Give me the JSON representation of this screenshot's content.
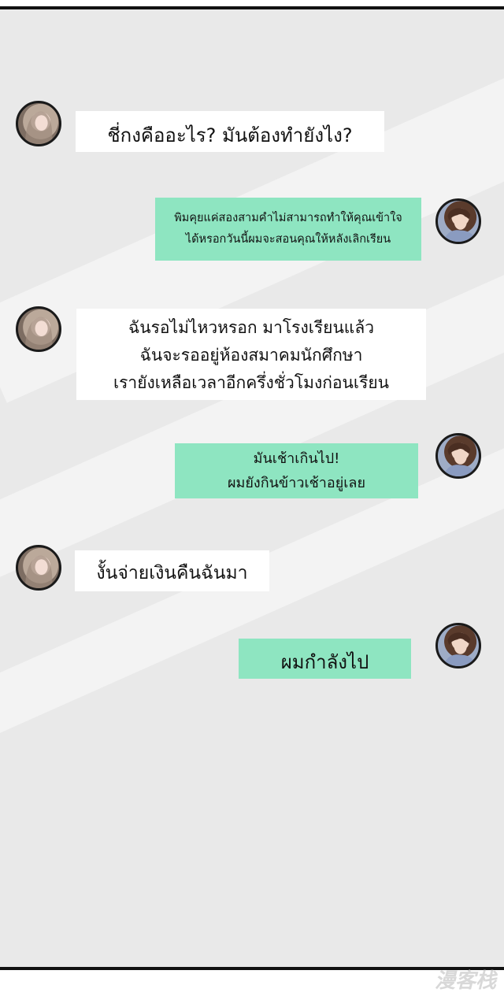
{
  "colors": {
    "background": "#e9e9e9",
    "incoming_bubble": "#ffffff",
    "outgoing_bubble": "#8ee5c1",
    "border": "#111111"
  },
  "messages": [
    {
      "sender": "girl",
      "lines": [
        "ชี่กงคืออะไร? มันต้องทำยังไง?"
      ]
    },
    {
      "sender": "boy",
      "lines": [
        "พิมคุยแค่สองสามคำไม่สามารถทำให้คุณเข้าใจ",
        "ได้หรอกวันนี้ผมจะสอนคุณให้หลังเลิกเรียน"
      ]
    },
    {
      "sender": "girl",
      "lines": [
        "ฉันรอไม่ไหวหรอก มาโรงเรียนแล้ว",
        "ฉันจะรออยู่ห้องสมาคมนักศึกษา",
        "เรายังเหลือเวลาอีกครึ่งชั่วโมงก่อนเรียน"
      ]
    },
    {
      "sender": "boy",
      "lines": [
        "มันเช้าเกินไป!",
        "ผมยังกินข้าวเช้าอยู่เลย"
      ]
    },
    {
      "sender": "girl",
      "lines": [
        "งั้นจ่ายเงินคืนฉันมา"
      ]
    },
    {
      "sender": "boy",
      "lines": [
        "ผมกำลังไป"
      ]
    }
  ],
  "watermark": "漫客栈"
}
